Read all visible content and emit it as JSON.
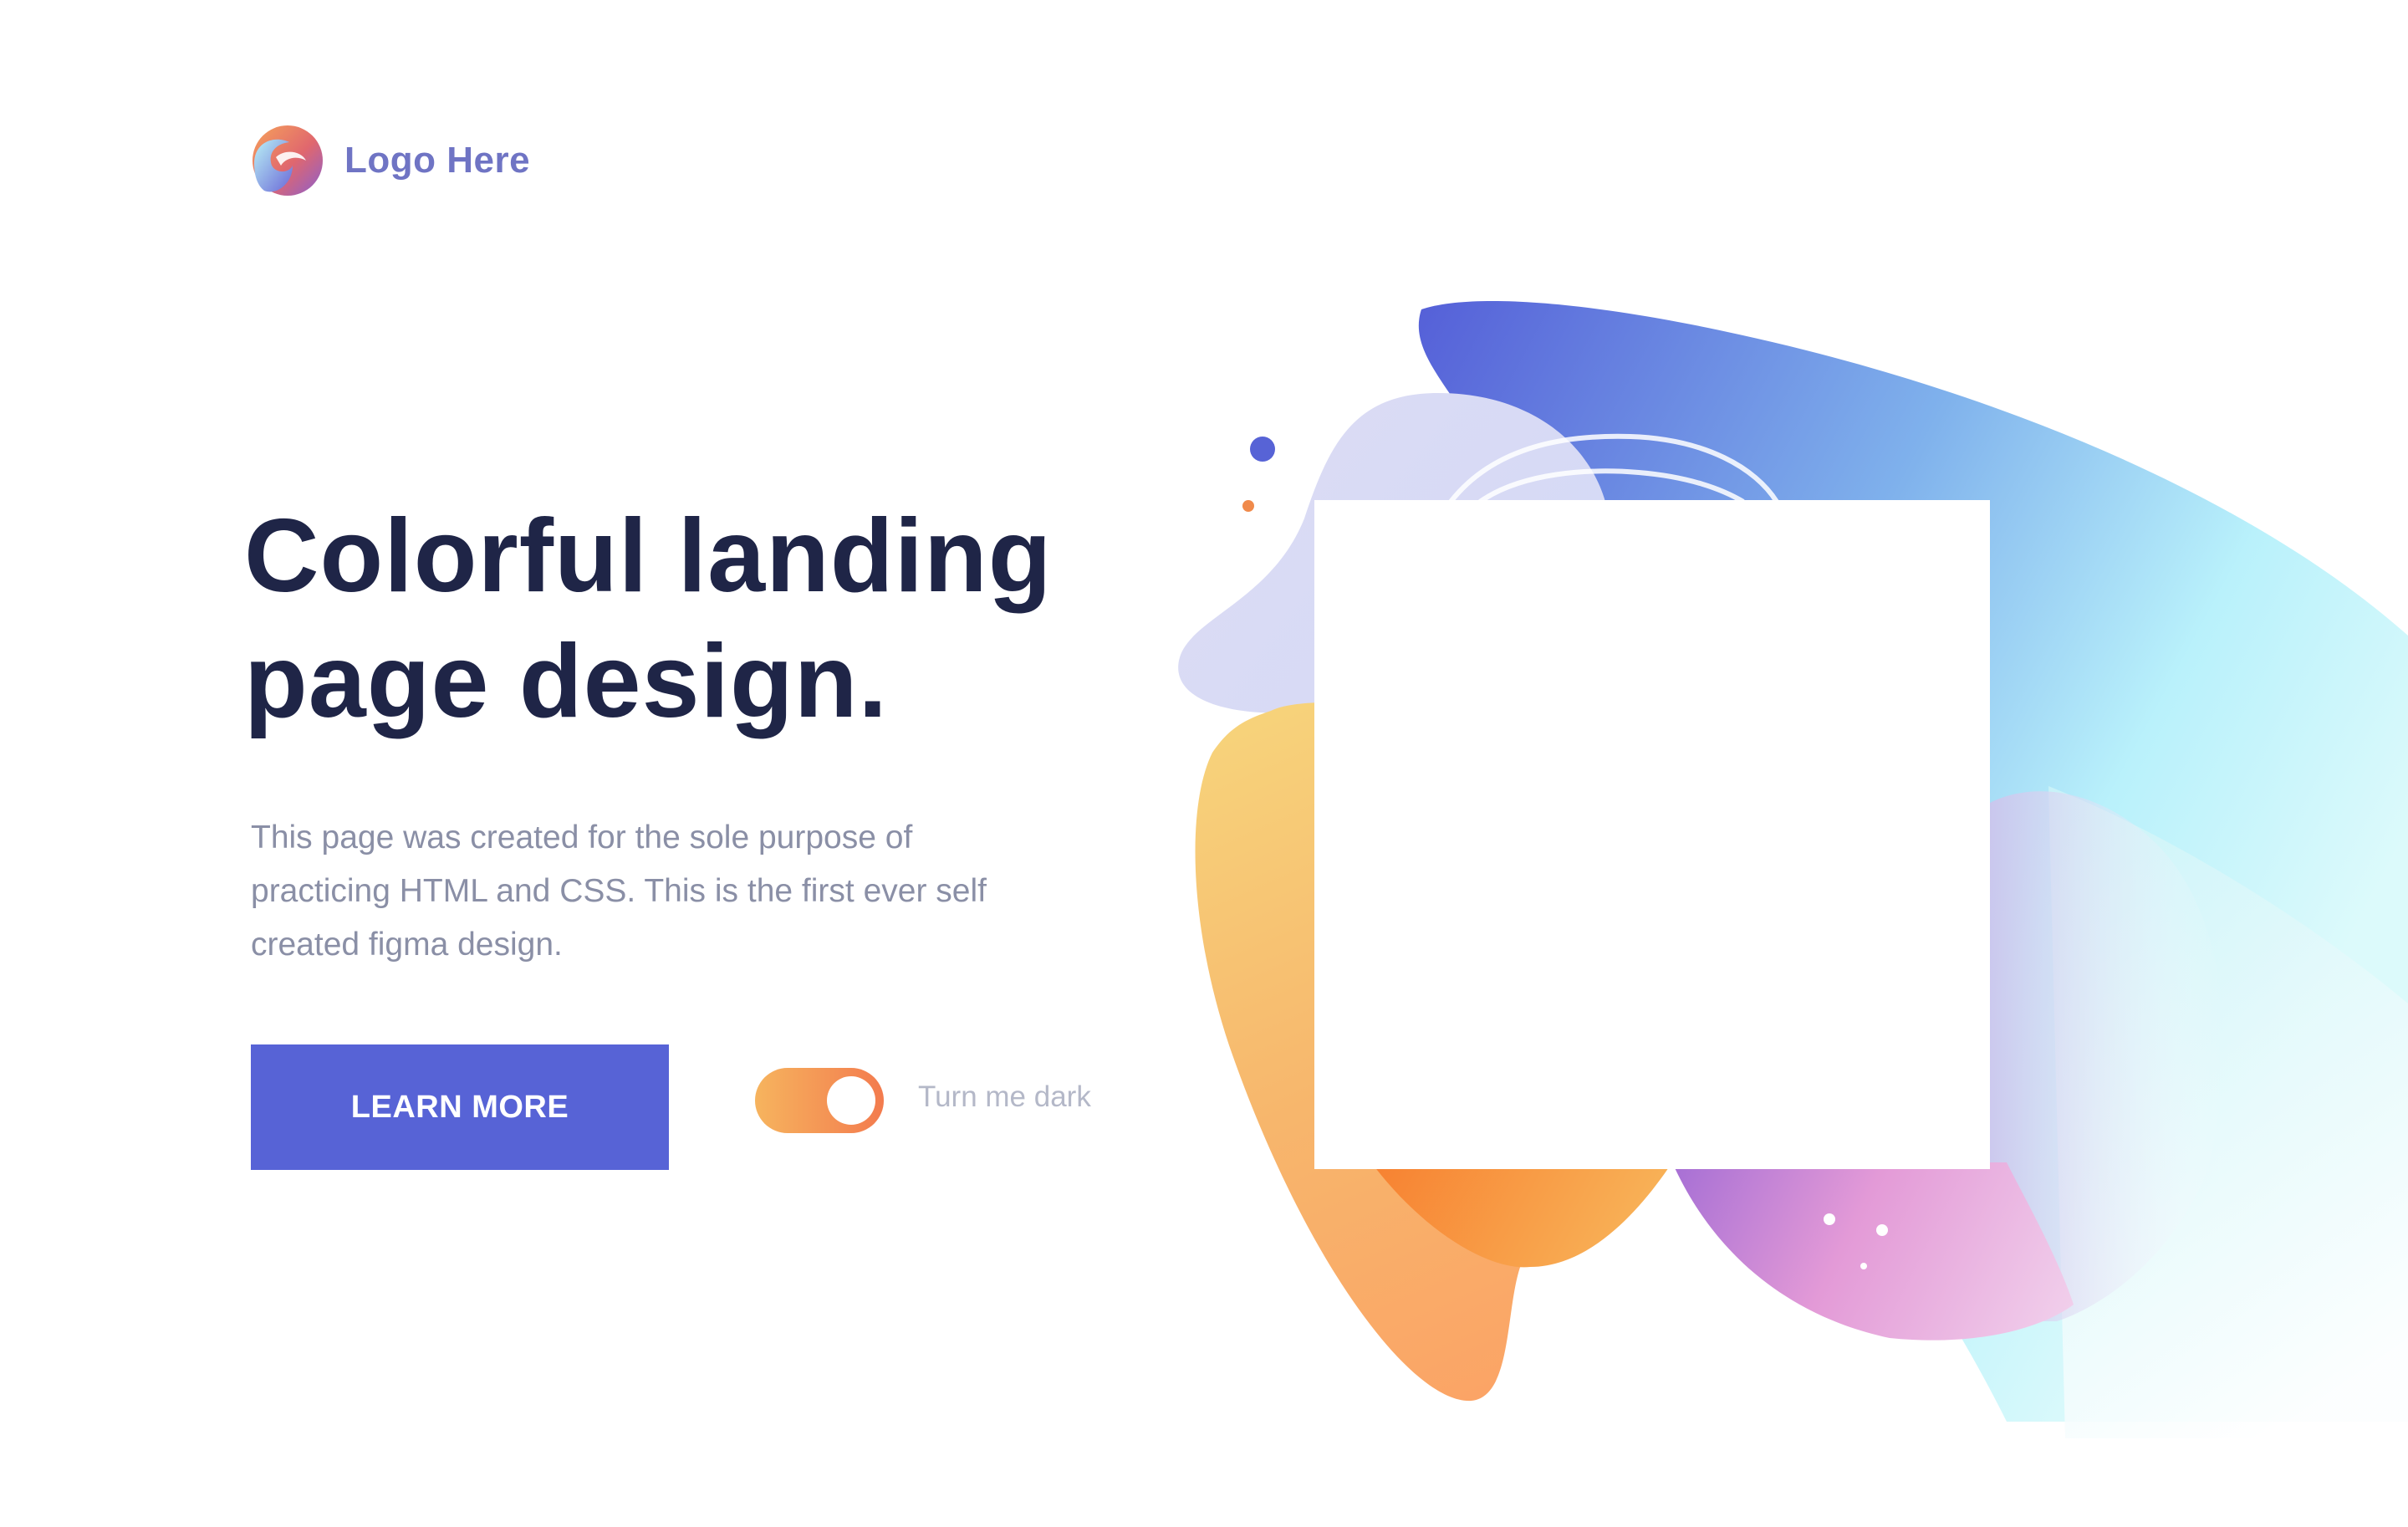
{
  "header": {
    "logo_text": "Logo Here"
  },
  "hero": {
    "title_line1": "Colorful landing",
    "title_line2": "page design.",
    "description": "This page was created for the sole purpose of\npracticing HTML and CSS.  This is the first ever self\ncreated figma design."
  },
  "cta": {
    "label": "LEARN MORE",
    "color": "#5763d6"
  },
  "theme_toggle": {
    "label": "Turn me dark",
    "state": "on"
  },
  "colors": {
    "title": "#1f2547",
    "body_text": "#8a8fa6",
    "logo_text": "#6f74c4"
  }
}
